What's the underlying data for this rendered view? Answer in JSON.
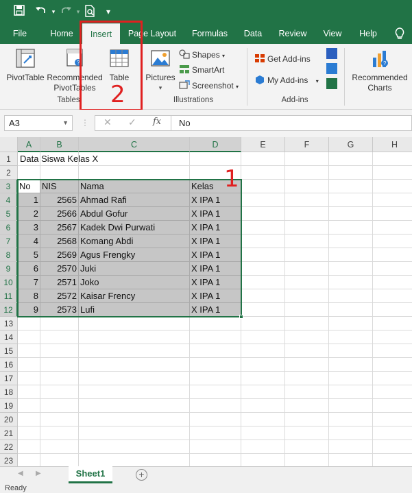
{
  "qat": {
    "icons": [
      "save-icon",
      "undo-icon",
      "redo-icon",
      "print-preview-icon",
      "customize-icon"
    ]
  },
  "tabs": [
    "File",
    "Home",
    "Insert",
    "Page Layout",
    "Formulas",
    "Data",
    "Review",
    "View",
    "Help"
  ],
  "active_tab": "Insert",
  "ribbon": {
    "tables": {
      "pivot": "PivotTable",
      "recommended_pivot_1": "Recommended",
      "recommended_pivot_2": "PivotTables",
      "table": "Table",
      "label": "Tables"
    },
    "illustrations": {
      "pictures": "Pictures",
      "shapes": "Shapes",
      "smartart": "SmartArt",
      "screenshot": "Screenshot",
      "label": "Illustrations"
    },
    "addins": {
      "get": "Get Add-ins",
      "my": "My Add-ins",
      "label": "Add-ins"
    },
    "charts": {
      "rec_1": "Recommended",
      "rec_2": "Charts"
    }
  },
  "annotations": {
    "one": "1",
    "two": "2"
  },
  "formula_bar": {
    "name_box": "A3",
    "fx": "fx",
    "value": "No"
  },
  "columns": [
    "A",
    "B",
    "C",
    "D",
    "E",
    "F",
    "G",
    "H"
  ],
  "rows": [
    "1",
    "2",
    "3",
    "4",
    "5",
    "6",
    "7",
    "8",
    "9",
    "10",
    "11",
    "12",
    "13",
    "14",
    "15",
    "16",
    "17",
    "18",
    "19",
    "20",
    "21",
    "22",
    "23"
  ],
  "sheet": {
    "title": "Data Siswa Kelas X",
    "headers": [
      "No",
      "NIS",
      "Nama",
      "Kelas"
    ],
    "records": [
      [
        "1",
        "2565",
        "Ahmad Rafi",
        "X IPA 1"
      ],
      [
        "2",
        "2566",
        "Abdul Gofur",
        "X IPA 1"
      ],
      [
        "3",
        "2567",
        "Kadek Dwi Purwati",
        "X IPA 1"
      ],
      [
        "4",
        "2568",
        "Komang Abdi",
        "X IPA 1"
      ],
      [
        "5",
        "2569",
        "Agus Frengky",
        "X IPA 1"
      ],
      [
        "6",
        "2570",
        "Juki",
        "X IPA 1"
      ],
      [
        "7",
        "2571",
        "Joko",
        "X IPA 1"
      ],
      [
        "8",
        "2572",
        "Kaisar Frency",
        "X IPA 1"
      ],
      [
        "9",
        "2573",
        "Lufi",
        "X IPA 1"
      ]
    ]
  },
  "sheet_tab": "Sheet1",
  "status": "Ready"
}
